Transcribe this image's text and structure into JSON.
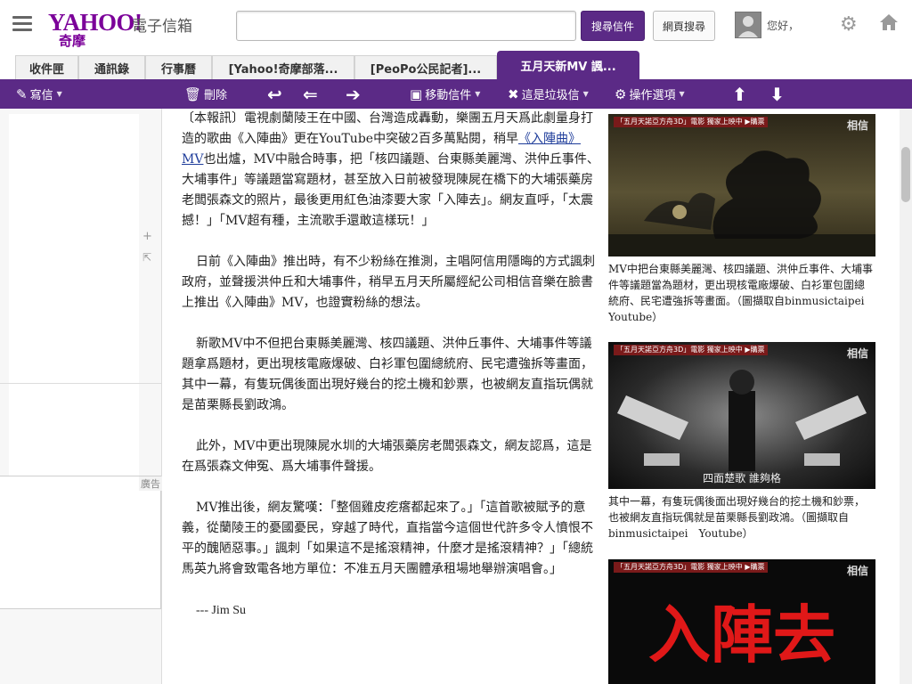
{
  "header": {
    "logo_text": "YAHOO!",
    "logo_sub": "奇摩",
    "product": "電子信箱",
    "search_placeholder": "",
    "search_mail_label": "搜尋信件",
    "search_web_label": "網頁搜尋",
    "greeting": "您好，"
  },
  "tabs": [
    {
      "label": "收件匣"
    },
    {
      "label": "通訊錄"
    },
    {
      "label": "行事曆"
    },
    {
      "label": "[Yahoo!奇摩部落..."
    },
    {
      "label": "[PeoPo公民記者]..."
    },
    {
      "label": "五月天新MV 諷..."
    }
  ],
  "toolbar": {
    "compose": "寫信",
    "delete": "刪除",
    "move": "移動信件",
    "spam": "這是垃圾信",
    "actions": "操作選項"
  },
  "ad": {
    "label": "廣告"
  },
  "article": {
    "p1_before": "〔本報訊〕電視劇蘭陵王在中國、台灣造成轟動，樂團五月天爲此劇量身打造的歌曲《入陣曲》更在YouTube中突破2百多萬點閱，稍早",
    "p1_link": "《入陣曲》MV",
    "p1_after": "也出爐，MV中融合時事，把「核四議題、台東縣美麗灣、洪仲丘事件、大埔事件」等議題當寫題材，甚至放入日前被發現陳屍在橋下的大埔張藥房老闆張森文的照片，最後更用紅色油漆要大家「入陣去」。網友直呼，「太震撼！」「MV超有種，主流歌手還敢這樣玩！」",
    "p2": "日前《入陣曲》推出時，有不少粉絲在推測，主唱阿信用隱晦的方式諷刺政府，並聲援洪仲丘和大埔事件，稍早五月天所屬經紀公司相信音樂在臉書上推出《入陣曲》MV，也證實粉絲的想法。",
    "p3": "新歌MV中不但把台東縣美麗灣、核四議題、洪仲丘事件、大埔事件等議題拿爲題材，更出現核電廠爆破、白衫軍包圍總統府、民宅遭強拆等畫面，其中一幕，有隻玩偶後面出現好幾台的挖土機和鈔票，也被網友直指玩偶就是苗栗縣長劉政鴻。",
    "p4": "此外，MV中更出現陳屍水圳的大埔張藥房老闆張森文，網友認爲，這是在爲張森文伸冤、爲大埔事件聲援。",
    "p5": "MV推出後，網友驚嘆：「整個雞皮疙瘩都起來了。」「這首歌被賦予的意義，從蘭陵王的憂國憂民，穿越了時代，直指當今這個世代許多令人憤恨不平的醜陋惡事。」諷刺「如果這不是搖滾精神，什麼才是搖滾精神？」「總統馬英九將會致電各地方單位：不准五月天團體承租場地舉辦演唱會。」",
    "signature": "--- Jim Su"
  },
  "images": [
    {
      "topbar": "「五月天諾亞方舟3D」電影 獨家上映中 ▶購票",
      "brand": "相信",
      "caption": "MV中把台東縣美麗灣、核四議題、洪仲丘事件、大埔事件等議題當為題材，更出現核電廠爆破、白衫軍包圍總統府、民宅遭強拆等畫面。（圖擷取自binmusictaipei　Youtube）"
    },
    {
      "topbar": "「五月天諾亞方舟3D」電影 獨家上映中 ▶購票",
      "brand": "相信",
      "subtitle": "四面楚歌 誰夠格",
      "caption": "其中一幕，有隻玩偶後面出現好幾台的挖土機和鈔票，也被網友直指玩偶就是苗栗縣長劉政鴻。（圖擷取自binmusictaipei　Youtube）"
    },
    {
      "topbar": "「五月天諾亞方舟3D」電影 獨家上映中 ▶購票",
      "brand": "相信",
      "overlay": "入陣去"
    }
  ],
  "colors": {
    "brand": "#5b2a86",
    "logo": "#7b0099",
    "link": "#1e3c9a"
  }
}
